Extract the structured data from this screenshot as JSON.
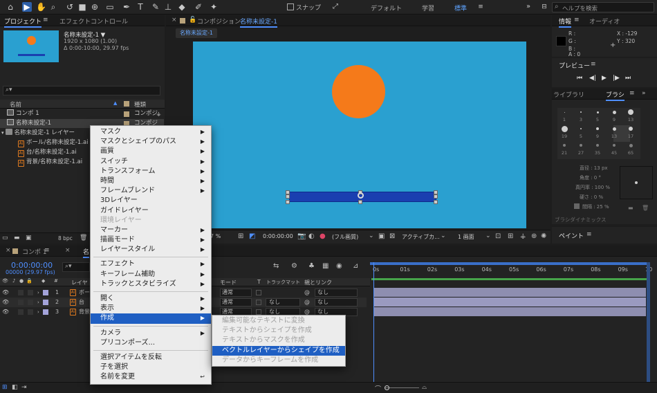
{
  "toolbar": {
    "snap_label": "スナップ",
    "workspaces": [
      "デフォルト",
      "学習",
      "標準"
    ],
    "search_placeholder": "ヘルプを検索"
  },
  "project_panel": {
    "tab_project": "プロジェクト",
    "tab_effects": "エフェクトコントロール ",
    "thumb_name": "名称未設定-1 ▼",
    "thumb_size": "1920 x 1080 (1.00)",
    "thumb_duration": "Δ 0:00:10:00, 29.97 fps",
    "col_name": "名前",
    "col_type": "種類",
    "items": [
      {
        "name": "コンポ 1",
        "type": "コンポジ"
      },
      {
        "name": "名称未設定-1",
        "type": "コンポジ"
      },
      {
        "name": "名称未設定-1 レイヤー",
        "type": ""
      },
      {
        "name": "ボール/名称未設定-1.ai",
        "type": ""
      },
      {
        "name": "台/名称未設定-1.ai",
        "type": ""
      },
      {
        "name": "背景/名称未設定-1.ai",
        "type": ""
      }
    ],
    "bpc": "8 bpc"
  },
  "composition": {
    "tab_label": "コンポジション",
    "tab_comp": "名称未設定-1",
    "sub_tab": "名称未設定-1",
    "zoom": "7 %",
    "timecode": "0:00:00:00",
    "quality": "(フル画質)",
    "camera": "アクティブカ...",
    "views": "1 画面",
    "bg_color": "#2aa0d0",
    "ball_color": "#f57a1a",
    "bar_color": "#1a3fb0"
  },
  "info_panel": {
    "tab_info": "情報",
    "tab_audio": "オーディオ",
    "r": "R :",
    "g": "G :",
    "b": "B :",
    "a": "A : 0",
    "x": "X : -129",
    "y": "Y :  320"
  },
  "preview_panel": {
    "title": "プレビュー"
  },
  "brush_panel": {
    "tab_library": "ライブラリ",
    "tab_brush": "ブラシ",
    "sizes": [
      "1",
      "3",
      "5",
      "9",
      "13",
      "19",
      "5",
      "9",
      "13",
      "17",
      "21",
      "27",
      "35",
      "45",
      "65"
    ],
    "diameter": "直径 : 13 px",
    "angle": "角度 : 0 °",
    "roundness": "真円率 : 100 %",
    "hardness": "硬さ : 0 %",
    "spacing": "間隔 : 25 %",
    "dynamics": "ブラシダイナミックス"
  },
  "paint_panel": {
    "title": "ペイント"
  },
  "timeline": {
    "tab_comp1": "コンポ 1",
    "tab_comp2": "名",
    "timecode": "0:00:00:00",
    "fps": "00000 (29.97 fps)",
    "col_layer": "レイヤ",
    "col_mode": "モード",
    "col_t": "T",
    "col_trackmatte": "トラックマット",
    "col_parent": "親とリンク",
    "ticks": [
      "0s",
      "01s",
      "02s",
      "03s",
      "04s",
      "05s",
      "06s",
      "07s",
      "08s",
      "09s",
      "10"
    ],
    "layers": [
      {
        "num": "1",
        "name": "ボー",
        "mode": "通常",
        "matte": "",
        "parent": "なし",
        "color": "#a3a3d9"
      },
      {
        "num": "2",
        "name": "台",
        "mode": "通常",
        "matte": "なし",
        "parent": "なし",
        "color": "#a3a3d9"
      },
      {
        "num": "3",
        "name": "背景",
        "mode": "通常",
        "matte": "なし",
        "parent": "なし",
        "color": "#a3a3d9"
      }
    ]
  },
  "context_menu": {
    "items": [
      {
        "label": "マスク",
        "arrow": true
      },
      {
        "label": "マスクとシェイプのパス",
        "arrow": true
      },
      {
        "label": "画質",
        "arrow": true
      },
      {
        "label": "スイッチ",
        "arrow": true
      },
      {
        "label": "トランスフォーム",
        "arrow": true
      },
      {
        "label": "時間",
        "arrow": true
      },
      {
        "label": "フレームブレンド",
        "arrow": true
      },
      {
        "label": "3Dレイヤー"
      },
      {
        "label": "ガイドレイヤー"
      },
      {
        "label": "環境レイヤー",
        "disabled": true
      },
      {
        "label": "マーカー",
        "arrow": true
      },
      {
        "label": "描画モード",
        "arrow": true
      },
      {
        "label": "レイヤースタイル",
        "arrow": true
      },
      {
        "sep": true
      },
      {
        "label": "エフェクト",
        "arrow": true
      },
      {
        "label": "キーフレーム補助",
        "arrow": true
      },
      {
        "label": "トラックとスタビライズ",
        "arrow": true
      },
      {
        "sep": true
      },
      {
        "label": "開く",
        "arrow": true
      },
      {
        "label": "表示",
        "arrow": true
      },
      {
        "label": "作成",
        "arrow": true,
        "highlight": true
      },
      {
        "sep": true
      },
      {
        "label": "カメラ",
        "arrow": true
      },
      {
        "label": "プリコンポーズ..."
      },
      {
        "sep": true
      },
      {
        "label": "選択アイテムを反転"
      },
      {
        "label": "子を選択"
      },
      {
        "label": "名前を変更",
        "shortcut": "↩"
      }
    ]
  },
  "submenu": {
    "items": [
      {
        "label": "編集可能なテキストに変換",
        "disabled": true
      },
      {
        "label": "テキストからシェイプを作成",
        "disabled": true
      },
      {
        "label": "テキストからマスクを作成",
        "disabled": true
      },
      {
        "label": "ベクトルレイヤーからシェイプを作成",
        "highlight": true
      },
      {
        "label": "データからキーフレームを作成",
        "disabled": true
      }
    ]
  }
}
